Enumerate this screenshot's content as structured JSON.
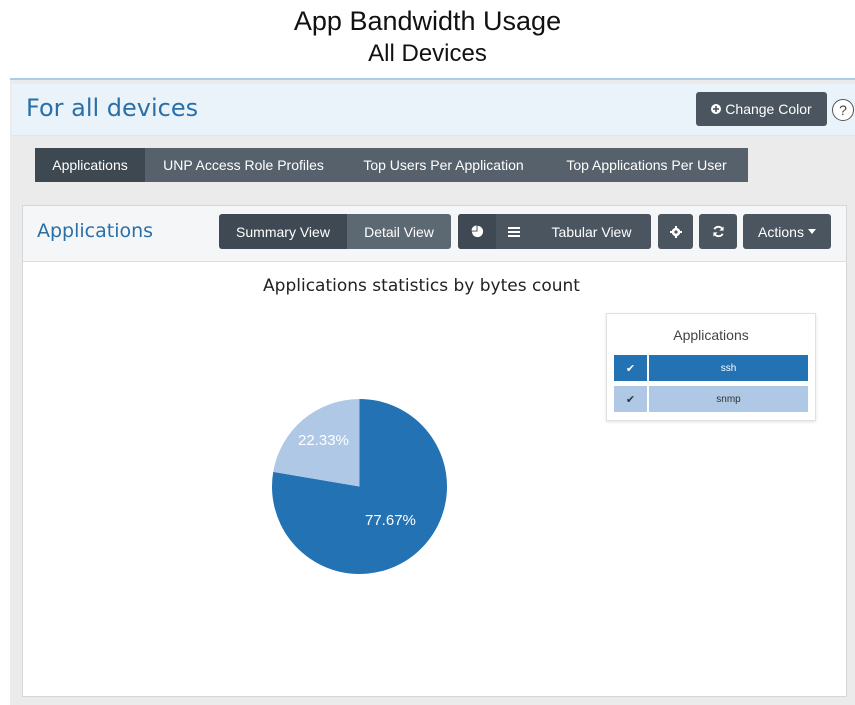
{
  "caption": {
    "title": "App Bandwidth Usage",
    "subtitle": "All Devices"
  },
  "header": {
    "title": "For all devices",
    "change_color_label": "Change Color",
    "help_glyph": "?"
  },
  "tabs": [
    {
      "label": "Applications",
      "active": true
    },
    {
      "label": "UNP Access Role Profiles",
      "active": false
    },
    {
      "label": "Top Users Per Application",
      "active": false
    },
    {
      "label": "Top Applications Per User",
      "active": false
    }
  ],
  "panel": {
    "title": "Applications",
    "summary_view_label": "Summary View",
    "detail_view_label": "Detail View",
    "tabular_view_label": "Tabular View",
    "actions_label": "Actions"
  },
  "icons": {
    "change_color": "circle-plus-icon",
    "pie": "pie-chart-icon",
    "table": "list-icon",
    "settings": "gear-icon",
    "refresh": "refresh-icon",
    "actions_caret": "caret-down-icon"
  },
  "chart_data": {
    "type": "pie",
    "title": "Applications statistics by bytes count",
    "legend_title": "Applications",
    "legend_position": "top-right",
    "slices": [
      {
        "label": "ssh",
        "percent": 77.67,
        "display": "77.67%",
        "color": "#2272b4",
        "checked": true
      },
      {
        "label": "snmp",
        "percent": 22.33,
        "display": "22.33%",
        "color": "#aec8e6",
        "checked": true
      }
    ]
  }
}
